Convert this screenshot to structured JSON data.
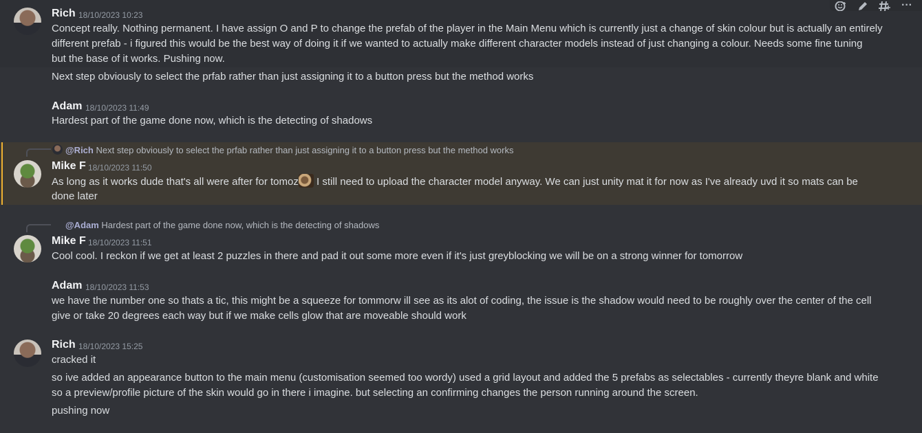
{
  "toolbar": {
    "icons": [
      "add-reaction-icon",
      "edit-icon",
      "create-thread-icon",
      "more-icon"
    ],
    "more_glyph": "···"
  },
  "messages": [
    {
      "author": "Rich",
      "timestamp": "18/10/2023 10:23",
      "lines": [
        "Concept really. Nothing permanent. I have assign O and P to change the prefab of the player in the Main Menu which is currently just a change of skin colour but is actually an entirely",
        "different prefab - i figured this would be the best way of doing it if we wanted to actually make different character models instead of just changing a colour. Needs some fine tuning",
        "but the base of it works. Pushing now."
      ],
      "followup": "Next step obviously to select the prfab rather than just assigning it to a button press but the method works"
    },
    {
      "author": "Adam",
      "timestamp": "18/10/2023 11:49",
      "lines": [
        "Hardest part of the game done now, which is the detecting of shadows"
      ]
    },
    {
      "reply_to_mention": "@Rich",
      "reply_to_text": "Next step obviously to select the prfab rather than just assigning it to a button press but the method works",
      "author": "Mike F",
      "timestamp": "18/10/2023 11:50",
      "line1_before_emoji": "As long as it works dude that's all were after for tomoz",
      "line1_after_emoji": " I still need to upload the character model anyway. We can just unity mat it for now as I've already uvd it so mats can be",
      "line2": "done later",
      "highlighted": true
    },
    {
      "reply_to_mention": "@Adam",
      "reply_to_text": "Hardest part of the game done now, which is the detecting of shadows",
      "author": "Mike F",
      "timestamp": "18/10/2023 11:51",
      "lines": [
        "Cool cool. I reckon if we get at least 2 puzzles in there and pad it out some more even if it's just greyblocking we will be on a strong winner for tomorrow"
      ]
    },
    {
      "author": "Adam",
      "timestamp": "18/10/2023 11:53",
      "lines": [
        "we have the number one so thats a tic, this might be a squeeze for tommorw ill see as its alot of coding, the issue is the shadow would need to be roughly over the center of the cell",
        "give or take 20 degrees each way but if we make cells glow that are moveable should work"
      ]
    },
    {
      "author": "Rich",
      "timestamp": "18/10/2023 15:25",
      "lines": [
        "cracked it"
      ],
      "followup_lines": [
        "so ive added an appearance button to the main menu (customisation seemed too wordy) used a grid layout and added the 5 prefabs as selectables - currently theyre blank and white",
        "so a preview/profile picture of the skin would go in there i imagine. but selecting an confirming changes the person running around the screen."
      ],
      "final": "pushing now"
    }
  ]
}
